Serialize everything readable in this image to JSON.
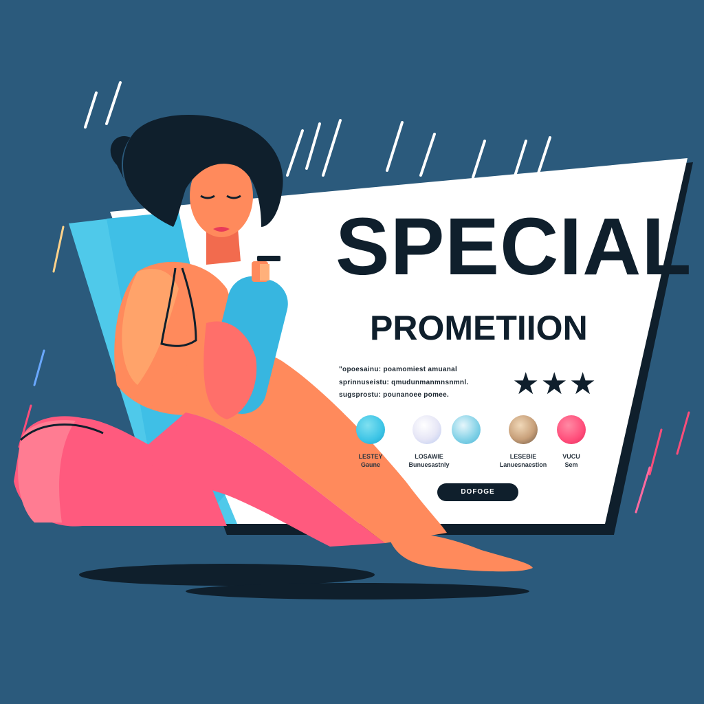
{
  "colors": {
    "background": "#2b5a7c",
    "panel": "#ffffff",
    "ink": "#0f1f2c",
    "accent_cyan": "#3cc4e6",
    "accent_pink": "#ff4d7a"
  },
  "promo": {
    "headline": "SPECIAL",
    "subheadline": "PROMETIION",
    "fine_print": [
      "\"opoesainu: poamomiest amuanal",
      "sprinnuseistu: qmudunmanmnsnmnl.",
      "sugsprostu: pounanoee pomee."
    ],
    "rating_stars": 3,
    "rating_glyphs": "★★★"
  },
  "swatches": [
    {
      "color": "#3cc4e6",
      "label_top": "LESTEY",
      "label_bottom": "Gaune"
    },
    {
      "color": "#e6e6f6",
      "label_top": "LOSAWIE",
      "label_bottom": "Bunuesastnly"
    },
    {
      "color": "#7fd0e6",
      "label_top": "",
      "label_bottom": ""
    },
    {
      "color": "#c8a07a",
      "label_top": "LESEBIE",
      "label_bottom": "Lanuesnaestion"
    },
    {
      "color": "#ff4d7a",
      "label_top": "VUCU",
      "label_bottom": "Sem"
    }
  ],
  "cta": {
    "label": "DOFOGE"
  }
}
